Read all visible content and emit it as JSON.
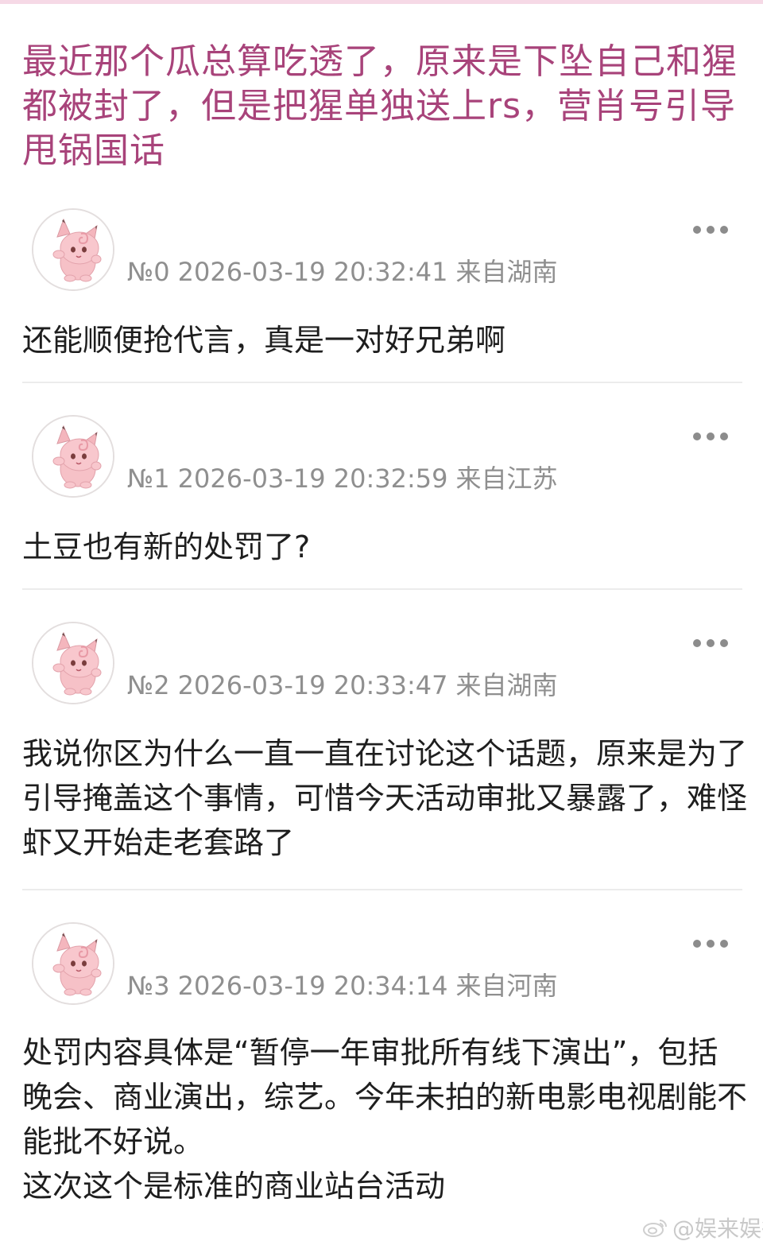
{
  "post": {
    "title": "最近那个瓜总算吃透了，原来是下坠自己和猩都被封了，但是把猩单独送上rs，营肖号引导甩锅国话"
  },
  "replies": [
    {
      "floor": "№0",
      "datetime": "2026-03-19 20:32:41",
      "location": "来自湖南",
      "content": "还能顺便抢代言，真是一对好兄弟啊"
    },
    {
      "floor": "№1",
      "datetime": "2026-03-19 20:32:59",
      "location": "来自江苏",
      "content": "土豆也有新的处罚了?"
    },
    {
      "floor": "№2",
      "datetime": "2026-03-19 20:33:47",
      "location": "来自湖南",
      "content": "我说你区为什么一直一直在讨论这个话题，原来是为了引导掩盖这个事情，可惜今天活动审批又暴露了，难怪虾又开始走老套路了"
    },
    {
      "floor": "№3",
      "datetime": "2026-03-19 20:34:14",
      "location": "来自河南",
      "content": "处罚内容具体是“暂停一年审批所有线下演出”，包括晚会、商业演出，综艺。今年未拍的新电影电视剧能不能批不好说。\n这次这个是标准的商业站台活动"
    }
  ],
  "icons": {
    "avatar": "pink-puff-avatar-icon",
    "more": "more-dots-icon",
    "watermark": "weibo-icon"
  },
  "watermark": {
    "text": "@娱来娱往L"
  },
  "colors": {
    "title": "#a8437a",
    "meta": "#8f8f8f",
    "content": "#1e1e1e",
    "divider": "#ececec",
    "top_strip": "#f6d9e6"
  }
}
